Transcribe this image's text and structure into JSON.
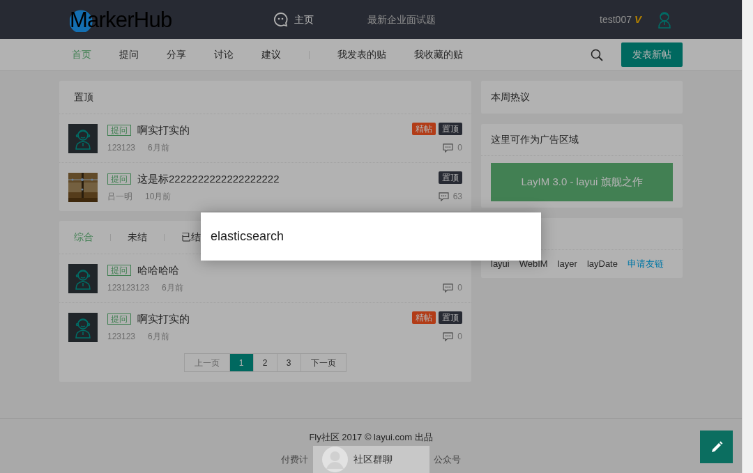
{
  "header": {
    "logo": "MarkerHub",
    "nav": [
      {
        "label": "主页",
        "kind": "icon"
      },
      {
        "label": "最新企业面试题",
        "kind": "plain"
      }
    ],
    "user": {
      "name": "test007",
      "vip": "V"
    }
  },
  "subnav": {
    "items": [
      {
        "label": "首页",
        "selected": true
      },
      {
        "label": "提问",
        "selected": false
      },
      {
        "label": "分享",
        "selected": false
      },
      {
        "label": "讨论",
        "selected": false
      },
      {
        "label": "建议",
        "selected": false
      }
    ],
    "my_items": [
      "我发表的贴",
      "我收藏的贴"
    ],
    "post_button": "发表新帖"
  },
  "top_posts": {
    "title": "置顶",
    "posts": [
      {
        "kind": "icon",
        "category": "提问",
        "title": "啊实打实的",
        "author": "123123",
        "time": "6月前",
        "badges": [
          {
            "label": "精帖",
            "kind": "featured"
          },
          {
            "label": "置顶",
            "kind": "top"
          }
        ],
        "comments": "0"
      },
      {
        "kind": "picture",
        "category": "提问",
        "title": "这是标2222222222222222222",
        "author": "吕一明",
        "time": "10月前",
        "badges": [
          {
            "label": "置顶",
            "kind": "top"
          }
        ],
        "comments": "63"
      }
    ]
  },
  "list": {
    "tabs": [
      {
        "label": "综合",
        "selected": true
      },
      {
        "label": "未结",
        "selected": false
      },
      {
        "label": "已结",
        "selected": false
      }
    ],
    "posts": [
      {
        "kind": "icon",
        "category": "提问",
        "title": "哈哈哈哈",
        "author": "123123123",
        "time": "6月前",
        "comments": "0"
      },
      {
        "kind": "icon",
        "category": "提问",
        "title": "啊实打实的",
        "author": "123123",
        "time": "6月前",
        "badges": [
          {
            "label": "精帖",
            "kind": "featured"
          },
          {
            "label": "置顶",
            "kind": "top"
          }
        ],
        "comments": "0"
      }
    ],
    "pagination": [
      {
        "label": "上一页",
        "kind": "prev",
        "disabled": true,
        "selected": false
      },
      {
        "label": "1",
        "kind": "page",
        "disabled": false,
        "selected": true
      },
      {
        "label": "2",
        "kind": "page",
        "disabled": false,
        "selected": false
      },
      {
        "label": "3",
        "kind": "page",
        "disabled": false,
        "selected": false
      },
      {
        "label": "下一页",
        "kind": "next",
        "disabled": false,
        "selected": false
      }
    ]
  },
  "sidebar": {
    "hot_title": "本周热议",
    "ad_title": "这里可作为广告区域",
    "ad_banner": "LayIM 3.0 - layui 旗舰之作",
    "links": [
      {
        "label": "layui",
        "kind": "plain"
      },
      {
        "label": "WebIM",
        "kind": "plain"
      },
      {
        "label": "layer",
        "kind": "plain"
      },
      {
        "label": "layDate",
        "kind": "plain"
      },
      {
        "label": "申请友链",
        "kind": "apply"
      }
    ]
  },
  "footer": {
    "line1": "Fly社区 2017 © layui.com 出品",
    "line2_left": "付费计",
    "line2_right": "公众号"
  },
  "chat_popup": {
    "label": "社区群聊"
  },
  "modal": {
    "text": "elasticsearch"
  }
}
